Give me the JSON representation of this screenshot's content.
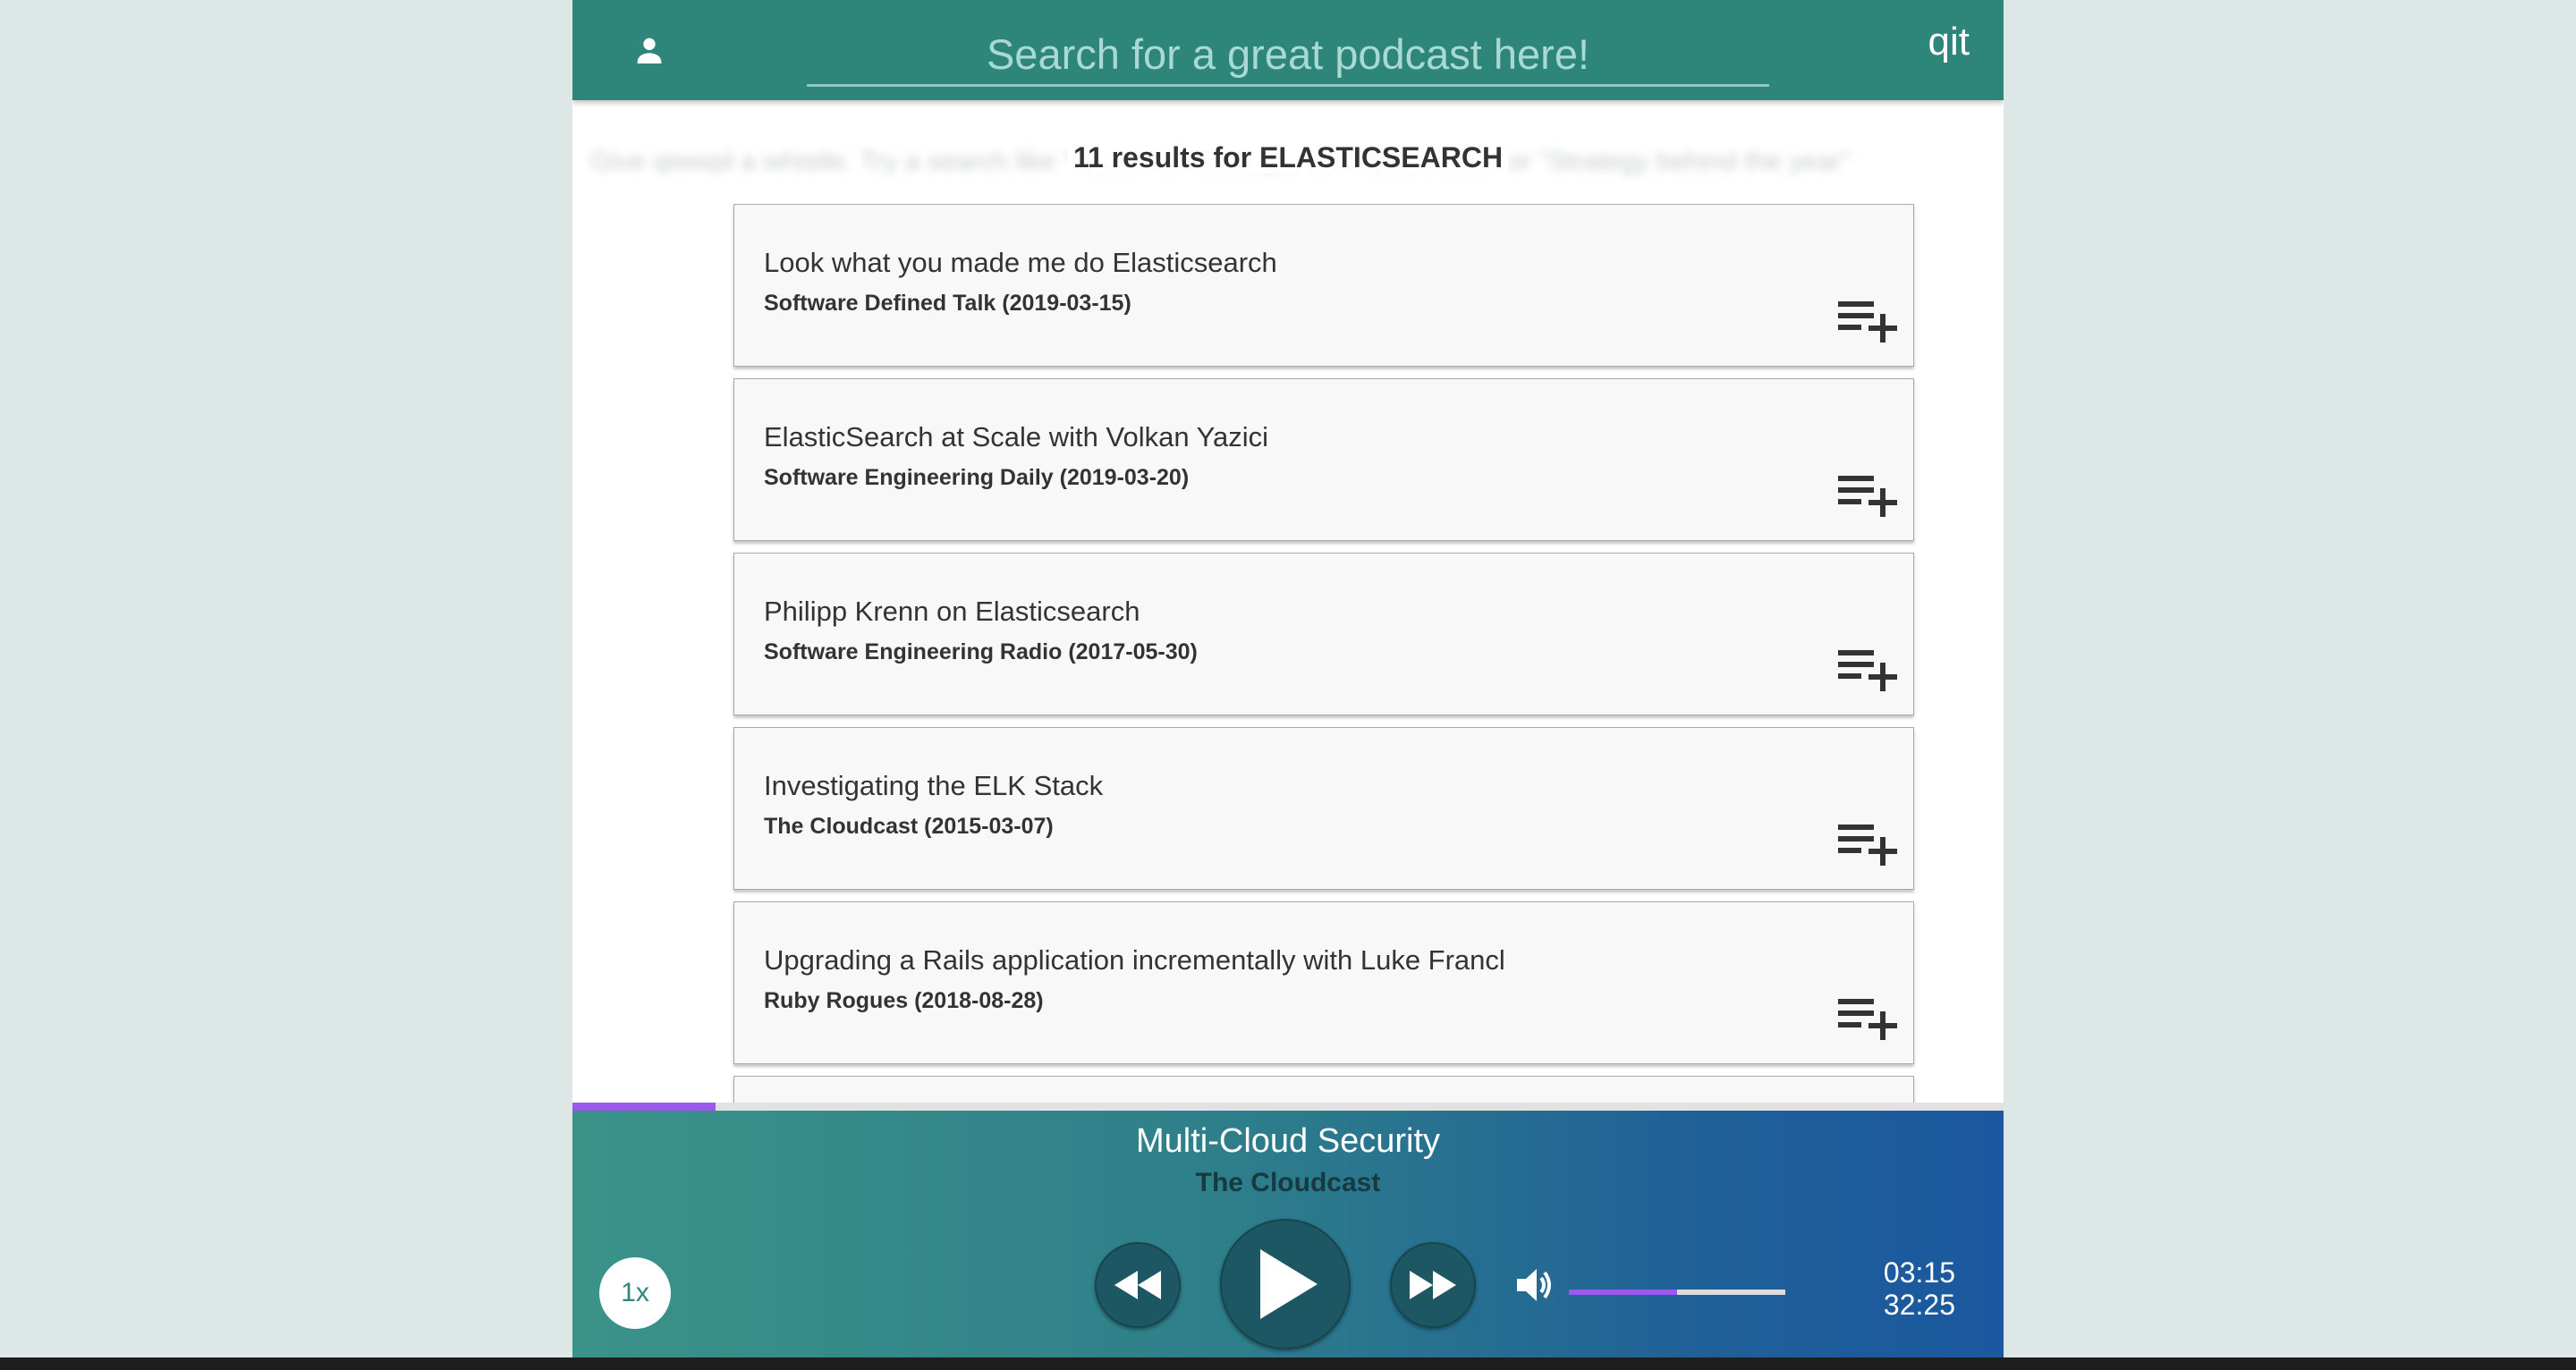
{
  "header": {
    "search_placeholder": "Search for a great podcast here!",
    "logo": "qit",
    "icons": {
      "user": "person-icon"
    }
  },
  "results": {
    "background_tagline": "Give qiwwpl a whistle. Try a search like \"React\" or \"startups\" or \"Kubernetes\" or \"Strategy behind the year\"",
    "title": "11 results for ELASTICSEARCH",
    "items": [
      {
        "title": "Look what you made me do Elasticsearch",
        "subtitle": "Software Defined Talk (2019-03-15)"
      },
      {
        "title": "ElasticSearch at Scale with Volkan Yazici",
        "subtitle": "Software Engineering Daily (2019-03-20)"
      },
      {
        "title": "Philipp Krenn on Elasticsearch",
        "subtitle": "Software Engineering Radio (2017-05-30)"
      },
      {
        "title": "Investigating the ELK Stack",
        "subtitle": "The Cloudcast (2015-03-07)"
      },
      {
        "title": "Upgrading a Rails application incrementally with Luke Francl",
        "subtitle": "Ruby Rogues (2018-08-28)"
      },
      {
        "title": "",
        "subtitle": ""
      }
    ],
    "add_icon": "playlist-add-icon"
  },
  "player": {
    "episode_title": "Multi-Cloud Security",
    "show_name": "The Cloudcast",
    "speed_label": "1x",
    "current_time": "03:15",
    "duration": "32:25",
    "progress_fraction": 0.1,
    "volume_fraction": 0.5,
    "icons": {
      "rewind": "rewind-icon",
      "play": "play-icon",
      "fast_forward": "fast-forward-icon",
      "volume": "volume-icon"
    },
    "colors": {
      "accent": "#9c59ec",
      "header": "#2e857a",
      "gradient_start": "#3a9389",
      "gradient_end": "#1b58a0"
    }
  }
}
